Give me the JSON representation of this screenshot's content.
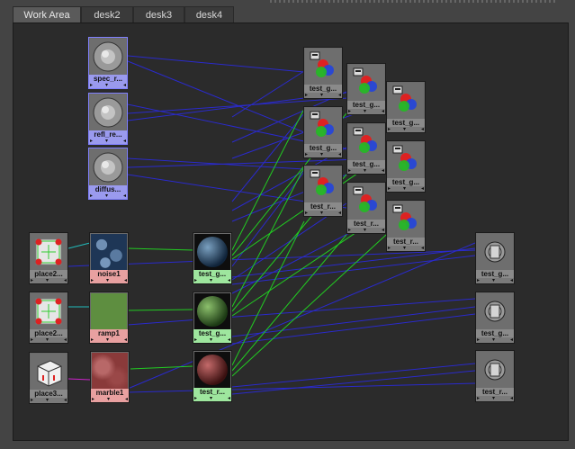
{
  "tabs": [
    {
      "label": "Work Area",
      "active": true
    },
    {
      "label": "desk2",
      "active": false
    },
    {
      "label": "desk3",
      "active": false
    },
    {
      "label": "desk4",
      "active": false
    }
  ],
  "port_markers": {
    "left": "▸",
    "mid": "▾",
    "right": "◂"
  },
  "colors": {
    "wire_blue": "#2a2acc",
    "wire_green": "#22cc22",
    "wire_magenta": "#cc22cc",
    "wire_cyan": "#22bbbb",
    "texture_label": "#e8a0a0",
    "shader_label": "#9ee69e",
    "file_label": "#9a9aee"
  },
  "nodes": {
    "spec": {
      "label": "spec_r...",
      "icon": "file-texture-icon"
    },
    "refl": {
      "label": "refl_re...",
      "icon": "file-texture-icon"
    },
    "diffuse": {
      "label": "diffus...",
      "icon": "file-texture-icon"
    },
    "place2d_1": {
      "label": "place2...",
      "icon": "place2d-icon"
    },
    "place2d_2": {
      "label": "place2...",
      "icon": "place2d-icon"
    },
    "place3d": {
      "label": "place3...",
      "icon": "place3d-icon"
    },
    "noise": {
      "label": "noise1",
      "icon": "noise-texture-icon"
    },
    "ramp": {
      "label": "ramp1",
      "icon": "ramp-texture-icon"
    },
    "marble": {
      "label": "marble1",
      "icon": "marble-texture-icon"
    },
    "shader1": {
      "label": "test_g...",
      "icon": "shader-sphere-icon"
    },
    "shader2": {
      "label": "test_g...",
      "icon": "shader-sphere-icon"
    },
    "shader3": {
      "label": "test_r...",
      "icon": "shader-sphere-icon"
    },
    "cc1": {
      "label": "test_g...",
      "icon": "color-correct-icon"
    },
    "cc2": {
      "label": "test_g...",
      "icon": "color-correct-icon"
    },
    "cc3": {
      "label": "test_g...",
      "icon": "color-correct-icon"
    },
    "cc4": {
      "label": "test_g...",
      "icon": "color-correct-icon"
    },
    "cc5": {
      "label": "test_g...",
      "icon": "color-correct-icon"
    },
    "cc6": {
      "label": "test_g...",
      "icon": "color-correct-icon"
    },
    "cc7": {
      "label": "test_r...",
      "icon": "color-correct-icon"
    },
    "cc8": {
      "label": "test_r...",
      "icon": "color-correct-icon"
    },
    "cc9": {
      "label": "test_r...",
      "icon": "color-correct-icon"
    },
    "sg1": {
      "label": "test_g...",
      "icon": "shading-group-icon"
    },
    "sg2": {
      "label": "test_g...",
      "icon": "shading-group-icon"
    },
    "sg3": {
      "label": "test_r...",
      "icon": "shading-group-icon"
    }
  }
}
